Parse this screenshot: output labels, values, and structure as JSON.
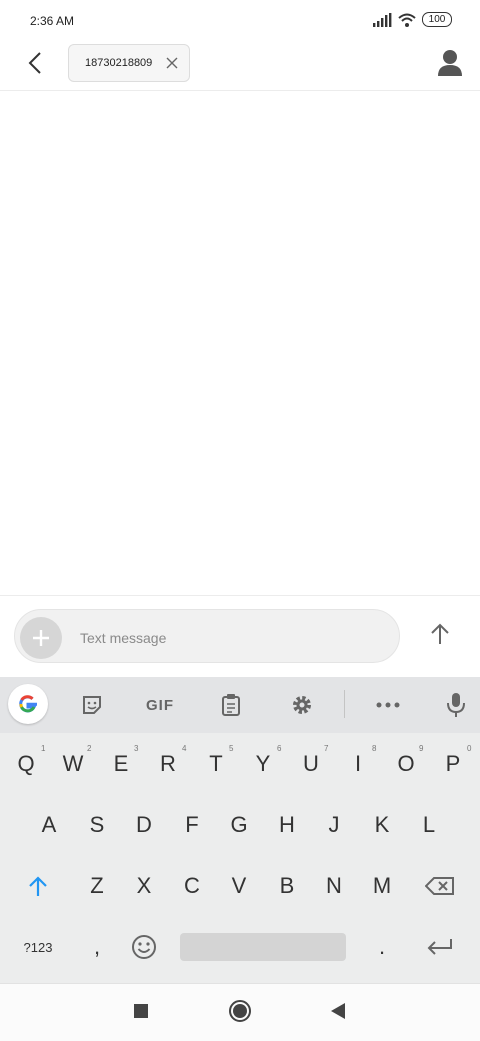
{
  "status_bar": {
    "time": "2:36 AM",
    "battery": "100",
    "icons": [
      "signal-icon",
      "wifi-icon",
      "battery-icon"
    ]
  },
  "header": {
    "recipient_chip": "18730218809",
    "back_icon": "chevron-left-icon",
    "chip_close_icon": "close-icon",
    "contact_icon": "person-icon"
  },
  "compose": {
    "placeholder": "Text message",
    "add_icon": "plus-icon",
    "send_icon": "arrow-up-icon"
  },
  "keyboard": {
    "toolbar": {
      "google": "G",
      "sticker_icon": "sticker-icon",
      "gif": "GIF",
      "clipboard_icon": "clipboard-icon",
      "settings_icon": "gear-icon",
      "more_icon": "more-icon",
      "mic_icon": "mic-icon"
    },
    "row1": [
      "Q",
      "W",
      "E",
      "R",
      "T",
      "Y",
      "U",
      "I",
      "O",
      "P"
    ],
    "row1_hints": [
      "1",
      "2",
      "3",
      "4",
      "5",
      "6",
      "7",
      "8",
      "9",
      "0"
    ],
    "row2": [
      "A",
      "S",
      "D",
      "F",
      "G",
      "H",
      "J",
      "K",
      "L"
    ],
    "row3": [
      "Z",
      "X",
      "C",
      "V",
      "B",
      "N",
      "M"
    ],
    "symbols_key": "?123",
    "comma": ",",
    "period": ".",
    "shift_icon": "shift-icon",
    "backspace_icon": "backspace-icon",
    "emoji_icon": "emoji-icon",
    "enter_icon": "enter-icon",
    "accent_color": "#2196f3"
  },
  "nav_bar": {
    "recents_icon": "square-icon",
    "home_icon": "home-circle-icon",
    "back_icon": "triangle-back-icon"
  }
}
